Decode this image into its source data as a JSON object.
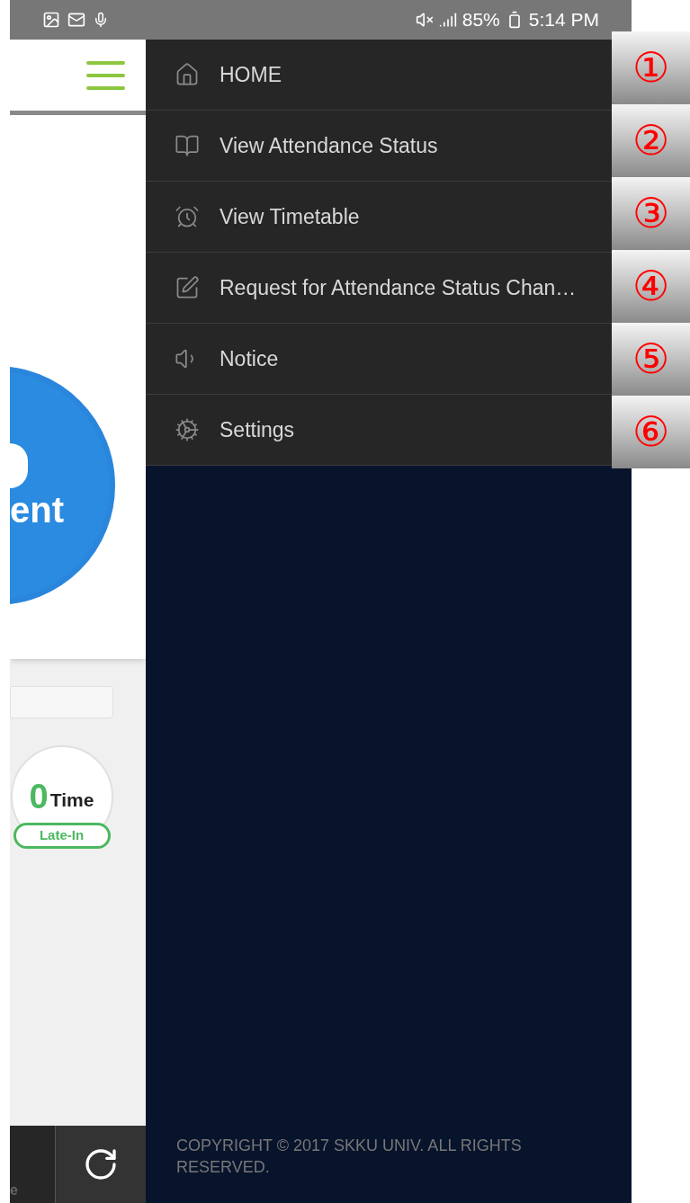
{
  "status_bar": {
    "battery": "85%",
    "time": "5:14 PM"
  },
  "main": {
    "circle_text": "ent",
    "late_count": {
      "number": "0",
      "unit": "Time",
      "label": "Late-In"
    },
    "bottom_tab_text": "e"
  },
  "drawer": {
    "items": [
      {
        "label": "HOME"
      },
      {
        "label": "View Attendance Status"
      },
      {
        "label": "View Timetable"
      },
      {
        "label": "Request for Attendance Status Chan…"
      },
      {
        "label": "Notice"
      },
      {
        "label": "Settings"
      }
    ],
    "copyright": "COPYRIGHT © 2017 SKKU UNIV. ALL RIGHTS RESERVED."
  },
  "annotations": [
    "①",
    "②",
    "③",
    "④",
    "⑤",
    "⑥"
  ]
}
